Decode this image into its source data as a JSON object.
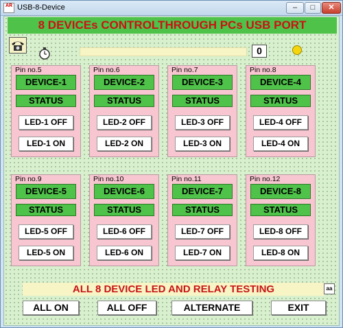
{
  "window": {
    "title": "USB-8-Device",
    "app_icon_text": "AR"
  },
  "header": {
    "title": "8 DEVICEs  CONTROLTHROUGH PCs USB PORT"
  },
  "toolbar": {
    "counter_value": "0"
  },
  "devices": [
    {
      "pin": "Pin no.5",
      "name": "DEVICE-1",
      "status": "STATUS",
      "off_label": "LED-1 OFF",
      "on_label": "LED-1 ON"
    },
    {
      "pin": "Pin no.6",
      "name": "DEVICE-2",
      "status": "STATUS",
      "off_label": "LED-2 OFF",
      "on_label": "LED-2 ON"
    },
    {
      "pin": "Pin no.7",
      "name": "DEVICE-3",
      "status": "STATUS",
      "off_label": "LED-3 OFF",
      "on_label": "LED-3 ON"
    },
    {
      "pin": "Pin no.8",
      "name": "DEVICE-4",
      "status": "STATUS",
      "off_label": "LED-4 OFF",
      "on_label": "LED-4 ON"
    },
    {
      "pin": "Pin no.9",
      "name": "DEVICE-5",
      "status": "STATUS",
      "off_label": "LED-5 OFF",
      "on_label": "LED-5 ON"
    },
    {
      "pin": "Pin no.10",
      "name": "DEVICE-6",
      "status": "STATUS",
      "off_label": "LED-6 OFF",
      "on_label": "LED-6 ON"
    },
    {
      "pin": "Pin no.11",
      "name": "DEVICE-7",
      "status": "STATUS",
      "off_label": "LED-7 OFF",
      "on_label": "LED-7 ON"
    },
    {
      "pin": "Pin no.12",
      "name": "DEVICE-8",
      "status": "STATUS",
      "off_label": "LED-8 OFF",
      "on_label": "LED-8 ON"
    }
  ],
  "banner": {
    "text": "ALL 8 DEVICE LED AND  RELAY TESTING",
    "font_icon_text": "aa"
  },
  "buttons": {
    "all_on": "ALL ON",
    "all_off": "ALL OFF",
    "alternate": "ALTERNATE",
    "exit": "EXIT"
  },
  "colors": {
    "header_bg": "#4fc24a",
    "header_text": "#c81414",
    "panel_bg": "#f8c6d0",
    "device_green": "#4fc24a",
    "led_indicator": "#f5d60d"
  }
}
